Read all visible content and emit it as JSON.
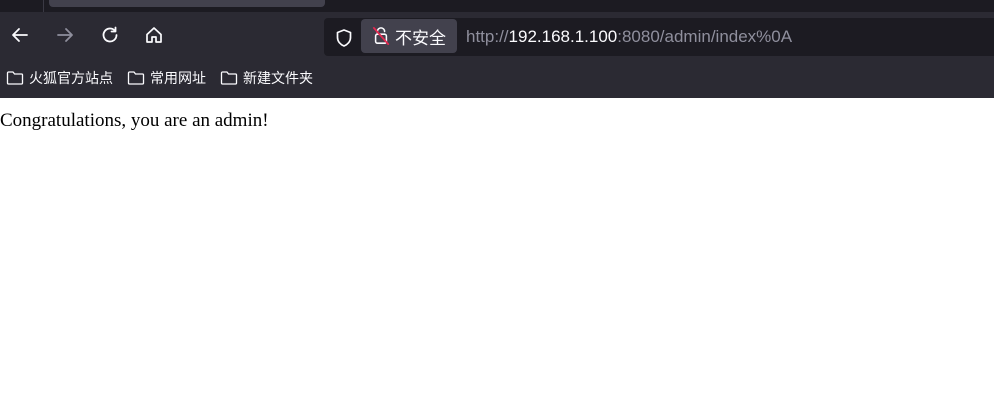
{
  "browser": {
    "security_label": "不安全",
    "url": {
      "scheme": "http://",
      "host": "192.168.1.100",
      "rest": ":8080/admin/index%0A"
    },
    "nav": {
      "back": "back-arrow",
      "forward": "forward-arrow",
      "reload": "reload",
      "home": "home"
    },
    "colors": {
      "toolbar": "#2b2a33",
      "urlbar": "#1c1b22",
      "text": "#fbfbfe",
      "dim_text": "#8f8f9d"
    }
  },
  "bookmarks": [
    {
      "label": "火狐官方站点",
      "icon": "folder-icon"
    },
    {
      "label": "常用网址",
      "icon": "folder-icon"
    },
    {
      "label": "新建文件夹",
      "icon": "folder-icon"
    }
  ],
  "page": {
    "message": "Congratulations, you are an admin!"
  }
}
